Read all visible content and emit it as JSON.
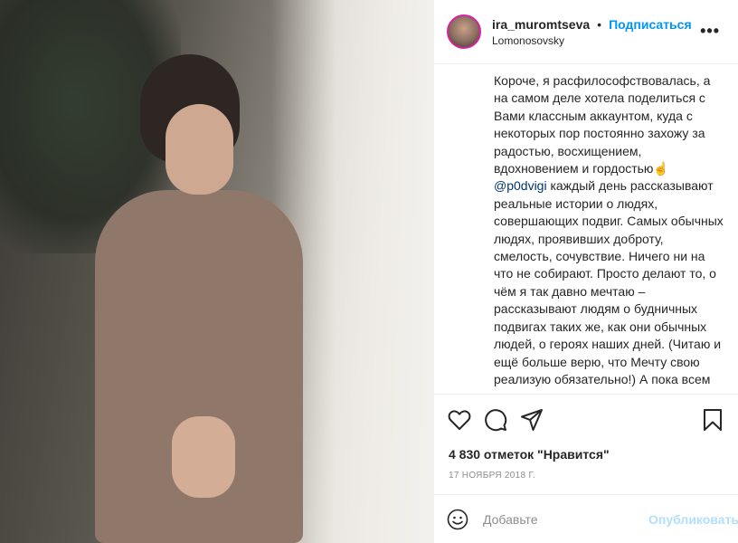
{
  "header": {
    "username": "ira_muromtseva",
    "separator": "•",
    "follow_label": "Подписаться",
    "location": "Lomonosovsky",
    "more_label": "•••"
  },
  "caption": {
    "text_before": "Короче, я расфилософствовалась, а на самом деле хотела поделиться с Вами классным аккаунтом, куда с некоторых пор постоянно захожу за радостью, восхищением, вдохновением и гордостью☝️ ",
    "mention": "@p0dvigi",
    "text_after": " каждый день рассказывают реальные истории о людях, совершающих подвиг. Самых обычных людях, проявивших доброту, смелость, сочувствие. Ничего ни на что не собирают. Просто делают то, о чём я так давно мечтаю – рассказывают людям о будничных подвигах таких же, как они обычных людей, о героях наших дней. (Читаю и ещё больше верю, что Мечту свою реализую обязательно!) А пока всем рекомендую – уж лучше"
  },
  "actions": {
    "like_icon": "heart-icon",
    "comment_icon": "comment-icon",
    "share_icon": "paper-plane-icon",
    "save_icon": "bookmark-icon"
  },
  "likes_text": "4 830 отметок \"Нравится\"",
  "date_text": "17 НОЯБРЯ 2018 Г.",
  "comment": {
    "emoji_icon": "smiley-icon",
    "placeholder": "Добавьте",
    "publish_label": "Опубликовать"
  },
  "colors": {
    "link_blue": "#0095f6",
    "publish_disabled": "#b2dffc",
    "mention": "#00376b"
  }
}
